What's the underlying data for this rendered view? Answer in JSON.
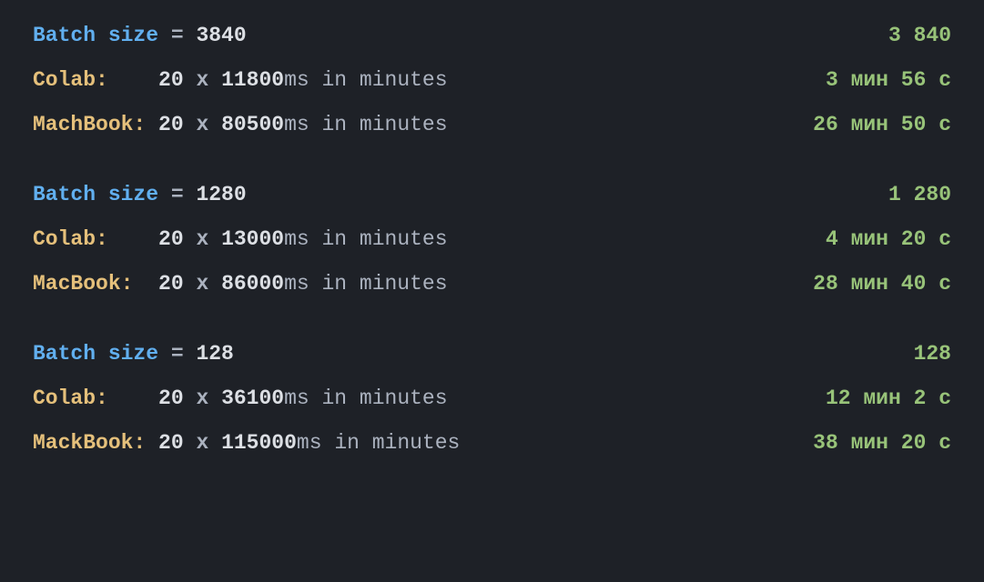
{
  "groups": [
    {
      "header": {
        "keyword": "Batch size",
        "eq": " = ",
        "value": "3840",
        "result": "3 840"
      },
      "rows": [
        {
          "label": "Colab:",
          "pad": "    ",
          "count": "20",
          "op": " x ",
          "ms": "11800",
          "unit_ms": "ms",
          "tail": " in minutes",
          "result": "3 мин 56 с"
        },
        {
          "label": "MachBook:",
          "pad": " ",
          "count": "20",
          "op": " x ",
          "ms": "80500",
          "unit_ms": "ms",
          "tail": " in minutes",
          "result": "26 мин 50 с"
        }
      ]
    },
    {
      "header": {
        "keyword": "Batch size",
        "eq": " = ",
        "value": "1280",
        "result": "1 280"
      },
      "rows": [
        {
          "label": "Colab:",
          "pad": "    ",
          "count": "20",
          "op": " x ",
          "ms": "13000",
          "unit_ms": "ms",
          "tail": " in minutes",
          "result": "4 мин 20 с"
        },
        {
          "label": "MacBook:",
          "pad": "  ",
          "count": "20",
          "op": " x ",
          "ms": "86000",
          "unit_ms": "ms",
          "tail": " in minutes",
          "result": "28 мин 40 с"
        }
      ]
    },
    {
      "header": {
        "keyword": "Batch size",
        "eq": " = ",
        "value": "128",
        "result": "128"
      },
      "rows": [
        {
          "label": "Colab:",
          "pad": "    ",
          "count": "20",
          "op": " x ",
          "ms": "36100",
          "unit_ms": "ms",
          "tail": " in minutes",
          "result": "12 мин 2 с"
        },
        {
          "label": "MackBook:",
          "pad": " ",
          "count": "20",
          "op": " x ",
          "ms": "115000",
          "unit_ms": "ms",
          "tail": " in minutes",
          "result": "38 мин 20 с"
        }
      ]
    }
  ]
}
